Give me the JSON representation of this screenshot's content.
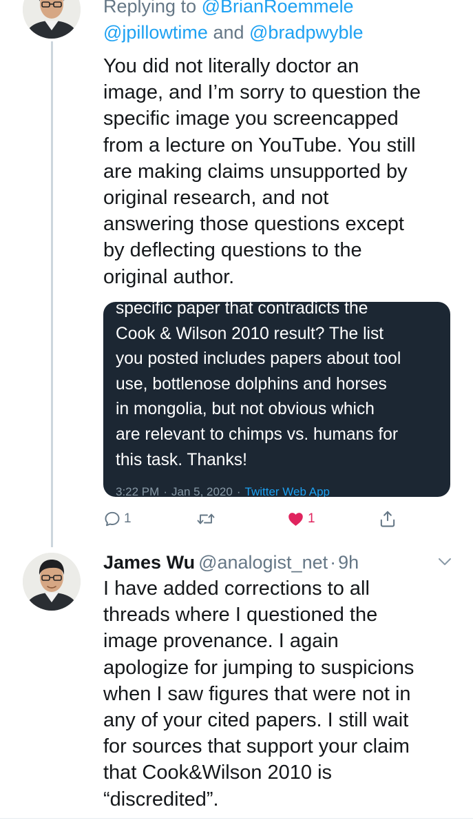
{
  "reply_context": {
    "prefix": "Replying to ",
    "mention1": "@BrianRoemmele",
    "mention2": "@jpillowtime",
    "conjunction": " and ",
    "mention3": "@bradpwyble"
  },
  "tweet1": {
    "text_lines": [
      "You did not literally doctor an",
      "image, and I’m sorry to question the",
      "specific image you screencapped",
      "from a lecture on YouTube. You still",
      "are making claims unsupported by",
      "original research, and not",
      "answering those questions except",
      "by deflecting questions to the",
      "original author."
    ],
    "embedded": {
      "text_lines": [
        "specific paper that contradicts the",
        "Cook & Wilson 2010 result?  The list",
        "you posted includes papers about tool",
        "use, bottlenose dolphins and horses",
        "in mongolia, but not obvious which",
        "are relevant to chimps vs. humans for",
        "this task. Thanks!"
      ],
      "time": "3:22 PM",
      "separator": "·",
      "date": "Jan 5, 2020",
      "app": "Twitter Web App"
    },
    "actions": {
      "reply_count": "1",
      "like_count": "1"
    }
  },
  "tweet2": {
    "author_name": "James Wu",
    "author_handle": "@analogist_net",
    "separator": "·",
    "time": "9h",
    "text_lines": [
      "I have added corrections to all",
      "threads where I questioned the",
      "image provenance. I again",
      "apologize for jumping to suspicions",
      "when I saw figures that were not in",
      "any of your cited papers. I still wait",
      "for sources that support your claim",
      "that Cook&Wilson 2010 is",
      "“discredited”."
    ]
  },
  "colors": {
    "accent": "#1da1f2",
    "secondary_text": "#657786",
    "like": "#e0245e",
    "embed_bg": "#1c2733",
    "thread_line": "#ccd6dd"
  },
  "icons": [
    "reply-icon",
    "retweet-icon",
    "heart-icon",
    "share-icon",
    "chevron-down-icon"
  ]
}
